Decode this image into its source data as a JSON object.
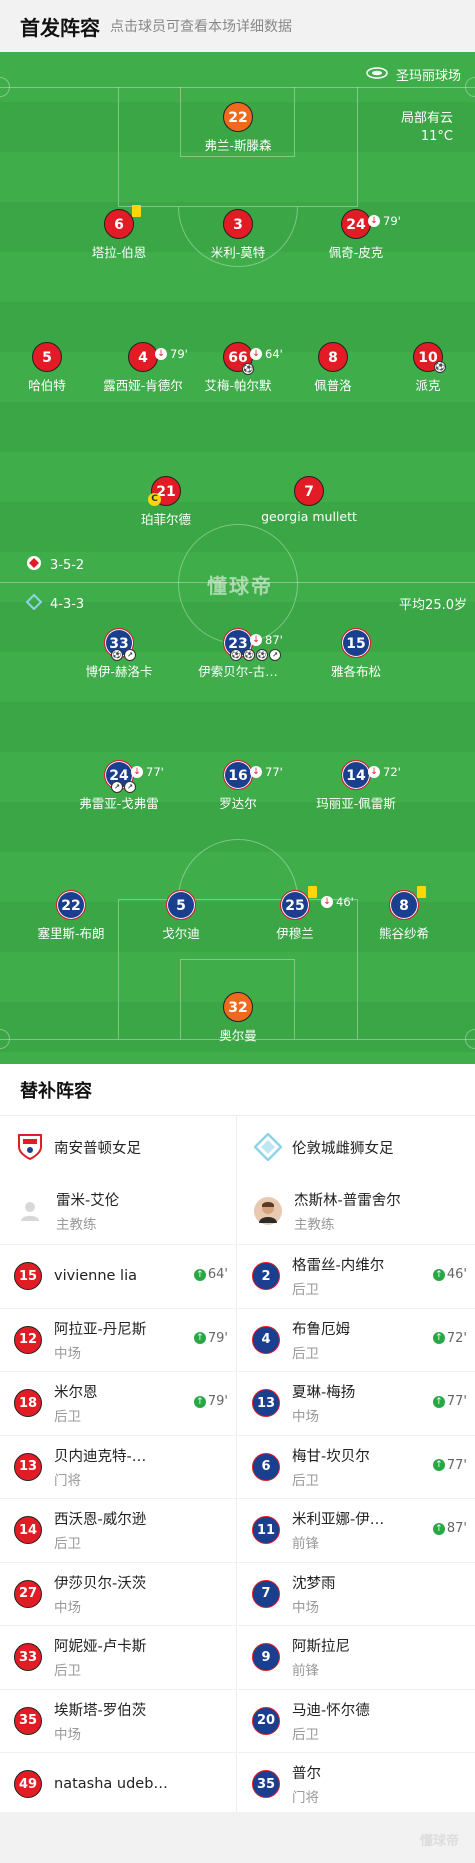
{
  "header": {
    "title": "首发阵容",
    "subtitle": "点击球员可查看本场详细数据"
  },
  "pitch": {
    "venue": "圣玛丽球场",
    "weather": "局部有云",
    "temperature": "11°C",
    "home_formation": "3-5-2",
    "away_formation": "4-3-3",
    "avg_age": "平均25.0岁",
    "watermark": "懂球帝"
  },
  "home_players": [
    {
      "number": "22",
      "name": "弗兰-斯滕森",
      "gk": true
    },
    {
      "number": "6",
      "name": "塔拉-伯恩",
      "yellow": true
    },
    {
      "number": "3",
      "name": "米利-莫特"
    },
    {
      "number": "24",
      "name": "佩奇-皮克",
      "sub_out": "79'"
    },
    {
      "number": "5",
      "name": "哈伯特"
    },
    {
      "number": "4",
      "name": "露西娅-肯德尔",
      "sub_out": "79'"
    },
    {
      "number": "66",
      "name": "艾梅-帕尔默",
      "sub_out": "64'"
    },
    {
      "number": "8",
      "name": "佩普洛"
    },
    {
      "number": "10",
      "name": "派克"
    },
    {
      "number": "21",
      "name": "珀菲尔德",
      "captain": "C"
    },
    {
      "number": "7",
      "name": "georgia mullett"
    }
  ],
  "away_players": [
    {
      "number": "33",
      "name": "博伊-赫洛卡"
    },
    {
      "number": "23",
      "name": "伊索贝尔-古…",
      "sub_out": "87'"
    },
    {
      "number": "15",
      "name": "雅各布松"
    },
    {
      "number": "24",
      "name": "弗雷亚-戈弗雷",
      "sub_out": "77'"
    },
    {
      "number": "16",
      "name": "罗达尔",
      "sub_out": "77'"
    },
    {
      "number": "14",
      "name": "玛丽亚-佩雷斯",
      "sub_out": "72'"
    },
    {
      "number": "22",
      "name": "塞里斯-布朗"
    },
    {
      "number": "5",
      "name": "戈尔迪"
    },
    {
      "number": "25",
      "name": "伊穆兰",
      "sub_out": "46'",
      "yellow": true
    },
    {
      "number": "8",
      "name": "熊谷纱希",
      "yellow": true
    },
    {
      "number": "32",
      "name": "奥尔曼",
      "gk": true
    }
  ],
  "subs": {
    "title": "替补阵容",
    "home": {
      "team": "南安普顿女足",
      "coach": {
        "name": "雷米-艾伦",
        "role": "主教练"
      },
      "players": [
        {
          "number": "15",
          "name": "vivienne lia",
          "pos": "",
          "in": "64'"
        },
        {
          "number": "12",
          "name": "阿拉亚-丹尼斯",
          "pos": "中场",
          "in": "79'"
        },
        {
          "number": "18",
          "name": "米尔恩",
          "pos": "后卫",
          "in": "79'"
        },
        {
          "number": "13",
          "name": "贝内迪克特-…",
          "pos": "门将",
          "in": ""
        },
        {
          "number": "14",
          "name": "西沃恩-威尔逊",
          "pos": "后卫",
          "in": ""
        },
        {
          "number": "27",
          "name": "伊莎贝尔-沃茨",
          "pos": "中场",
          "in": ""
        },
        {
          "number": "33",
          "name": "阿妮娅-卢卡斯",
          "pos": "后卫",
          "in": ""
        },
        {
          "number": "35",
          "name": "埃斯塔-罗伯茨",
          "pos": "中场",
          "in": ""
        },
        {
          "number": "49",
          "name": "natasha udeb…",
          "pos": "",
          "in": ""
        }
      ]
    },
    "away": {
      "team": "伦敦城雌狮女足",
      "coach": {
        "name": "杰斯林-普雷舍尔",
        "role": "主教练"
      },
      "players": [
        {
          "number": "2",
          "name": "格雷丝-内维尔",
          "pos": "后卫",
          "in": "46'"
        },
        {
          "number": "4",
          "name": "布鲁厄姆",
          "pos": "后卫",
          "in": "72'"
        },
        {
          "number": "13",
          "name": "夏琳-梅扬",
          "pos": "中场",
          "in": "77'"
        },
        {
          "number": "6",
          "name": "梅甘-坎贝尔",
          "pos": "后卫",
          "in": "77'"
        },
        {
          "number": "11",
          "name": "米利亚娜-伊…",
          "pos": "前锋",
          "in": "87'"
        },
        {
          "number": "7",
          "name": "沈梦雨",
          "pos": "中场",
          "in": ""
        },
        {
          "number": "9",
          "name": "阿斯拉尼",
          "pos": "前锋",
          "in": ""
        },
        {
          "number": "20",
          "name": "马迪-怀尔德",
          "pos": "后卫",
          "in": ""
        },
        {
          "number": "35",
          "name": "普尔",
          "pos": "门将",
          "in": ""
        }
      ]
    }
  },
  "footer": {
    "watermark": "懂球帝"
  },
  "colors": {
    "pitch": "#3fad4a",
    "home": "#e11c24",
    "away": "#1b3f8f",
    "goalkeeper": "#f06a1e"
  }
}
